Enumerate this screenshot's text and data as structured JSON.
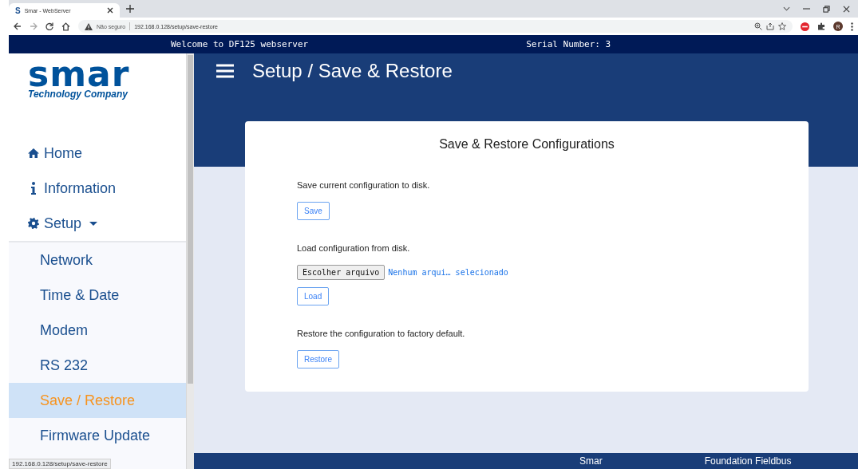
{
  "browser": {
    "tab_title": "Smar - WebServer",
    "tab_favicon": "S",
    "security": "Não seguro",
    "url": "192.168.0.128/setup/save-restore",
    "profile_initial": "R",
    "status_url": "192.168.0.128/setup/save-restore"
  },
  "top_bar": {
    "welcome": "Welcome to DF125 webserver",
    "serial": "Serial Number: 3"
  },
  "sidebar": {
    "logo": {
      "name": "smar",
      "tagline": "Technology Company"
    },
    "items": [
      {
        "label": "Home",
        "kind": "home",
        "selected": false
      },
      {
        "label": "Information",
        "kind": "info",
        "selected": false
      },
      {
        "label": "Setup",
        "kind": "gear",
        "selected": false,
        "expanded": true,
        "children": [
          {
            "label": "Network",
            "selected": false
          },
          {
            "label": "Time & Date",
            "selected": false
          },
          {
            "label": "Modem",
            "selected": false
          },
          {
            "label": "RS 232",
            "selected": false
          },
          {
            "label": "Save / Restore",
            "selected": true
          },
          {
            "label": "Firmware Update",
            "selected": false
          }
        ]
      }
    ]
  },
  "header": {
    "title": "Setup / Save & Restore"
  },
  "card": {
    "title": "Save & Restore Configurations",
    "sections": [
      {
        "kind": "button",
        "text": "Save current configuration to disk.",
        "button": "Save"
      },
      {
        "kind": "file",
        "text": "Load configuration from disk.",
        "file_button": "Escolher arquivo",
        "file_status": "Nenhum arqui… selecionado",
        "button": "Load"
      },
      {
        "kind": "button",
        "text": "Restore the configuration to factory default.",
        "button": "Restore"
      }
    ]
  },
  "footer": {
    "left": "Smar",
    "right": "Foundation Fieldbus"
  }
}
